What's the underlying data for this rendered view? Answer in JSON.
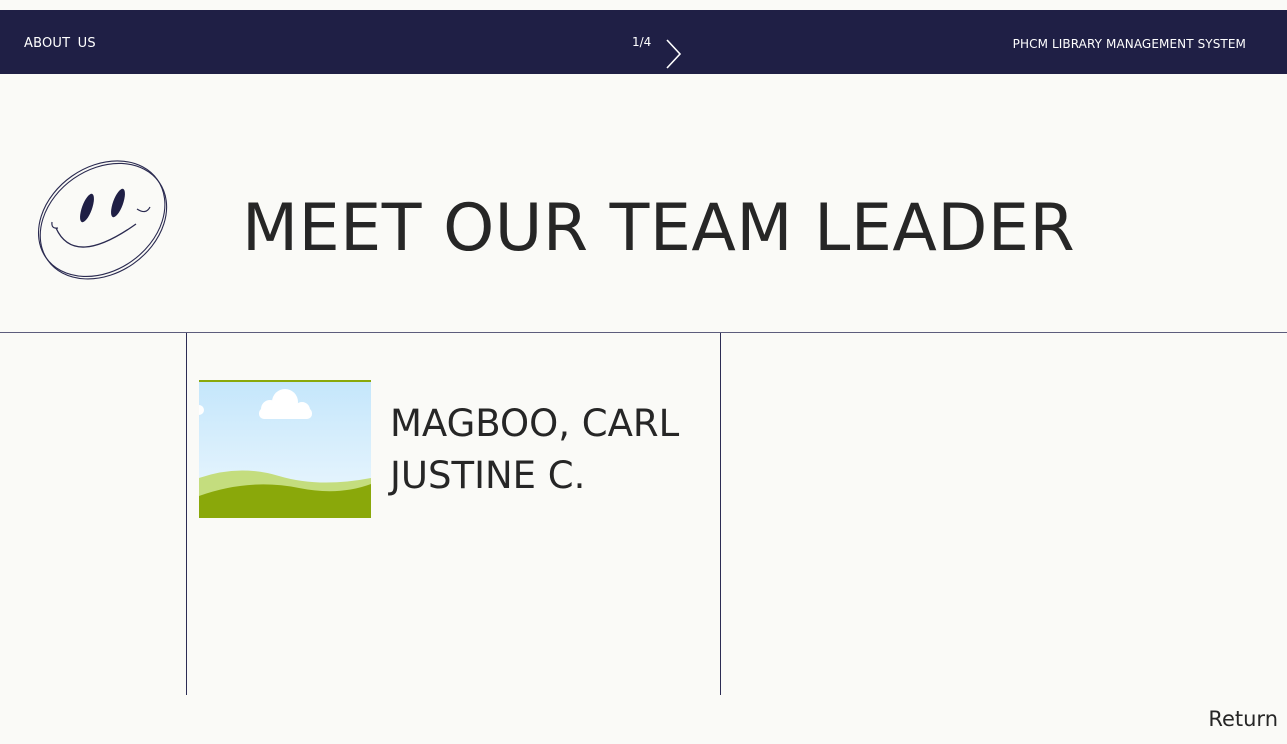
{
  "header": {
    "section_label": "ABOUT  US",
    "page_indicator": "1/4",
    "next_icon": "chevron-right-icon",
    "system_name": "PHCM LIBRARY MANAGEMENT SYSTEM"
  },
  "main": {
    "title": "MEET OUR TEAM LEADER",
    "decoration_icon": "smiley-face-icon",
    "leader": {
      "name": "MAGBOO, CARL JUSTINE C.",
      "photo_icon": "landscape-placeholder-icon"
    }
  },
  "footer": {
    "return_label": "Return"
  },
  "colors": {
    "header_background": "#1f1f45",
    "page_background": "#fafaf7",
    "text": "#262626",
    "header_text": "#ffffff"
  }
}
